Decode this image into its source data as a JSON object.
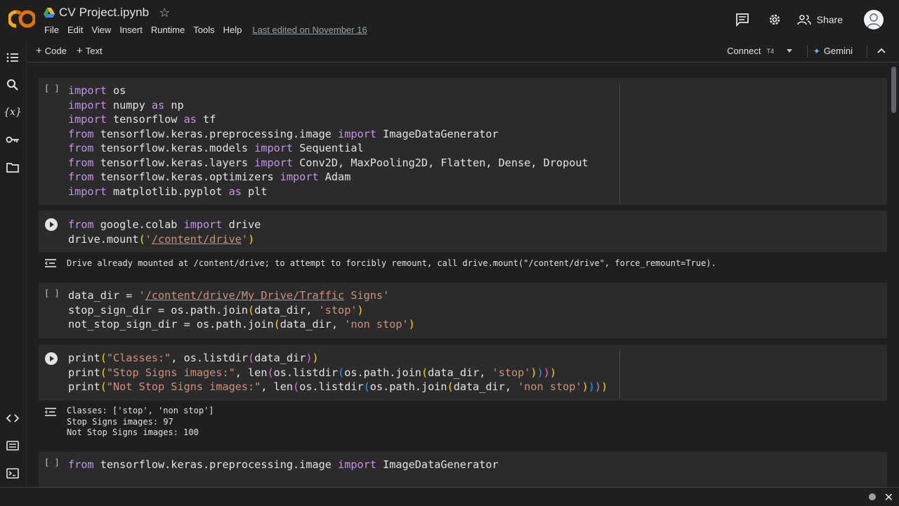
{
  "header": {
    "logo_text": "CO",
    "doc_title": "CV Project.ipynb",
    "menu": [
      "File",
      "Edit",
      "View",
      "Insert",
      "Runtime",
      "Tools",
      "Help"
    ],
    "last_edited": "Last edited on November 16",
    "share_label": "Share"
  },
  "toolbar": {
    "add_code": "Code",
    "add_text": "Text",
    "connect": "Connect",
    "runtime": "T4",
    "gemini": "Gemini"
  },
  "cells": {
    "c1": {
      "exec": "[ ]"
    },
    "c3": {
      "exec": "[ ]"
    },
    "c5": {
      "exec": "[ ]"
    }
  },
  "outputs": {
    "o2": [
      "Drive already mounted at /content/drive; to attempt to forcibly remount, call drive.mount(\"/content/drive\", force_remount=True)."
    ],
    "o4": [
      "Classes: ['stop', 'non stop']",
      "Stop Signs images: 97",
      "Not Stop Signs images: 100"
    ]
  },
  "colors": {
    "background": "#1f1f1f",
    "cell": "#2b2b2b",
    "keyword": "#c792ea",
    "string": "#ce9178",
    "accent": "#f9ab00"
  }
}
